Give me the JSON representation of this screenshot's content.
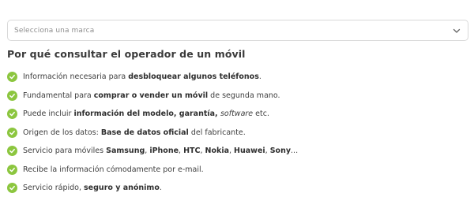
{
  "brand_select": {
    "placeholder": "Selecciona una marca",
    "icon": "chevron-down-icon"
  },
  "section": {
    "title": "Por qué consultar el operador de un móvil"
  },
  "colors": {
    "check": "#8cc63f",
    "text": "#3d3d3d"
  },
  "benefits": [
    {
      "segments": [
        {
          "t": "Información necesaria para ",
          "s": "n"
        },
        {
          "t": "desbloquear algunos teléfonos",
          "s": "b"
        },
        {
          "t": ".",
          "s": "n"
        }
      ]
    },
    {
      "segments": [
        {
          "t": "Fundamental para ",
          "s": "n"
        },
        {
          "t": "comprar o vender un móvil",
          "s": "b"
        },
        {
          "t": " de segunda mano.",
          "s": "n"
        }
      ]
    },
    {
      "segments": [
        {
          "t": "Puede incluir ",
          "s": "n"
        },
        {
          "t": "información del modelo, garantía, ",
          "s": "b"
        },
        {
          "t": "software",
          "s": "i"
        },
        {
          "t": " etc.",
          "s": "n"
        }
      ]
    },
    {
      "segments": [
        {
          "t": "Origen de los datos: ",
          "s": "n"
        },
        {
          "t": "Base de datos oficial",
          "s": "b"
        },
        {
          "t": " del fabricante.",
          "s": "n"
        }
      ]
    },
    {
      "segments": [
        {
          "t": "Servicio para móviles ",
          "s": "n"
        },
        {
          "t": "Samsung",
          "s": "b"
        },
        {
          "t": ", ",
          "s": "n"
        },
        {
          "t": "iPhone",
          "s": "b"
        },
        {
          "t": ", ",
          "s": "n"
        },
        {
          "t": "HTC",
          "s": "b"
        },
        {
          "t": ", ",
          "s": "n"
        },
        {
          "t": "Nokia",
          "s": "b"
        },
        {
          "t": ", ",
          "s": "n"
        },
        {
          "t": "Huawei",
          "s": "b"
        },
        {
          "t": ", ",
          "s": "n"
        },
        {
          "t": "Sony",
          "s": "b"
        },
        {
          "t": "...",
          "s": "n"
        }
      ]
    },
    {
      "segments": [
        {
          "t": "Recibe la información cómodamente por e-mail.",
          "s": "n"
        }
      ]
    },
    {
      "segments": [
        {
          "t": "Servicio rápido, ",
          "s": "n"
        },
        {
          "t": "seguro y anónimo",
          "s": "b"
        },
        {
          "t": ".",
          "s": "n"
        }
      ]
    }
  ]
}
